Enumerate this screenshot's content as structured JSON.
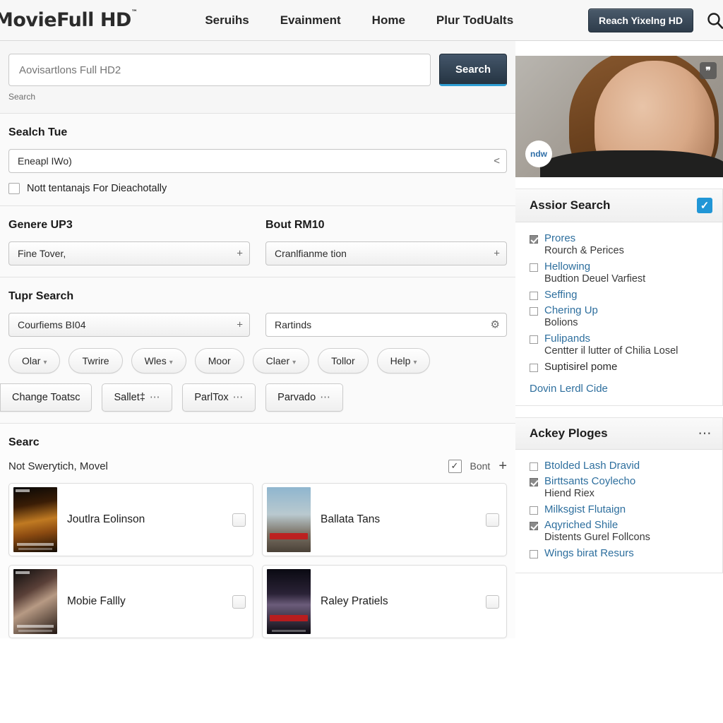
{
  "header": {
    "logo": "MovieFull HD",
    "logo_tm": "™",
    "nav": [
      {
        "label": "Seruihs"
      },
      {
        "label": "Evainment"
      },
      {
        "label": "Home"
      },
      {
        "label": "Plur TodUalts"
      }
    ],
    "cta_label": "Reach Yixelng HD",
    "search_icon": "search-icon"
  },
  "search_panel": {
    "input_value": "Aovisartlons Full HD2",
    "input_placeholder": "Aovisartlons Full HD2",
    "button_label": "Search",
    "sub_label": "Search"
  },
  "search_type": {
    "title": "Sealch Tue",
    "select_value": "Eneapl IWo)",
    "select_affix": "<",
    "checkbox_label": "Nott tentanajs For Dieachotally",
    "checkbox_checked": false
  },
  "genre_section": {
    "left": {
      "title": "Genere UP3",
      "value": "Fine Tover,",
      "affix": "+"
    },
    "right": {
      "title": "Bout RM10",
      "value": "Cranlfianme tion",
      "affix": "+"
    }
  },
  "tupr_search": {
    "title": "Tupr Search",
    "left": {
      "value": "Courfiems BI04",
      "affix": "+"
    },
    "right": {
      "value": "Rartinds",
      "affix": "gear-icon"
    },
    "pills": [
      {
        "label": "Olar",
        "caret": true
      },
      {
        "label": "Twrire",
        "caret": false
      },
      {
        "label": "Wles",
        "caret": true
      },
      {
        "label": "Moor",
        "caret": false
      },
      {
        "label": "Claer",
        "caret": true
      },
      {
        "label": "Tollor",
        "caret": false
      },
      {
        "label": "Help",
        "caret": true
      }
    ],
    "rect_buttons": [
      {
        "label": "Change Toatsc",
        "dots": false
      },
      {
        "label": "Sallet‡",
        "dots": true
      },
      {
        "label": "ParlTox",
        "dots": true
      },
      {
        "label": "Parvado",
        "dots": true
      }
    ]
  },
  "results": {
    "title": "Searc",
    "note": "Not Swerytich, Movel",
    "tool_checkbox_checked": true,
    "tool_label": "Bont",
    "plus_icon": "plus-icon",
    "cards": [
      {
        "title": "Joutlra Eolinson",
        "checked": false,
        "poster": "p1"
      },
      {
        "title": "Ballata Tans",
        "checked": false,
        "poster": "p2"
      },
      {
        "title": "Mobie Fallly",
        "checked": false,
        "poster": "p3"
      },
      {
        "title": "Raley Pratiels",
        "checked": false,
        "poster": "p4"
      }
    ]
  },
  "promo": {
    "badge_text": "ndw",
    "corner_icon": "person-running-icon"
  },
  "sidebar": {
    "assior": {
      "title": "Assior Search",
      "header_check_checked": true,
      "accent": "#2196d6",
      "items": [
        {
          "label": "Prores",
          "sub": "Rourch & Perices",
          "checked": true
        },
        {
          "label": "Hellowing",
          "sub": "Budtion Deuel Varfiest",
          "checked": false
        },
        {
          "label": "Seffing",
          "sub": "",
          "checked": false
        },
        {
          "label": "Chering Up",
          "sub": "Bolions",
          "checked": false
        },
        {
          "label": "Fulipands",
          "sub": "Centter il lutter of Chilia Losel",
          "checked": false
        },
        {
          "label": "Suptisirel pome",
          "sub": "",
          "checked": false
        }
      ],
      "footer_link": "Dovin Lerdl Cide"
    },
    "ackey": {
      "title": "Ackey Ploges",
      "menu_icon": "kebab-menu-icon",
      "items": [
        {
          "label": "Btolded Lash Dravid",
          "sub": "",
          "checked": false
        },
        {
          "label": "Birttsants Coylecho",
          "sub": "Hiend Riex",
          "checked": true
        },
        {
          "label": "Milksgist Flutaign",
          "sub": "",
          "checked": false
        },
        {
          "label": "Aqyriched Shile",
          "sub": "Distents Gurel Follcons",
          "checked": true
        },
        {
          "label": "Wings birat Resurs",
          "sub": "",
          "checked": false
        }
      ]
    }
  }
}
